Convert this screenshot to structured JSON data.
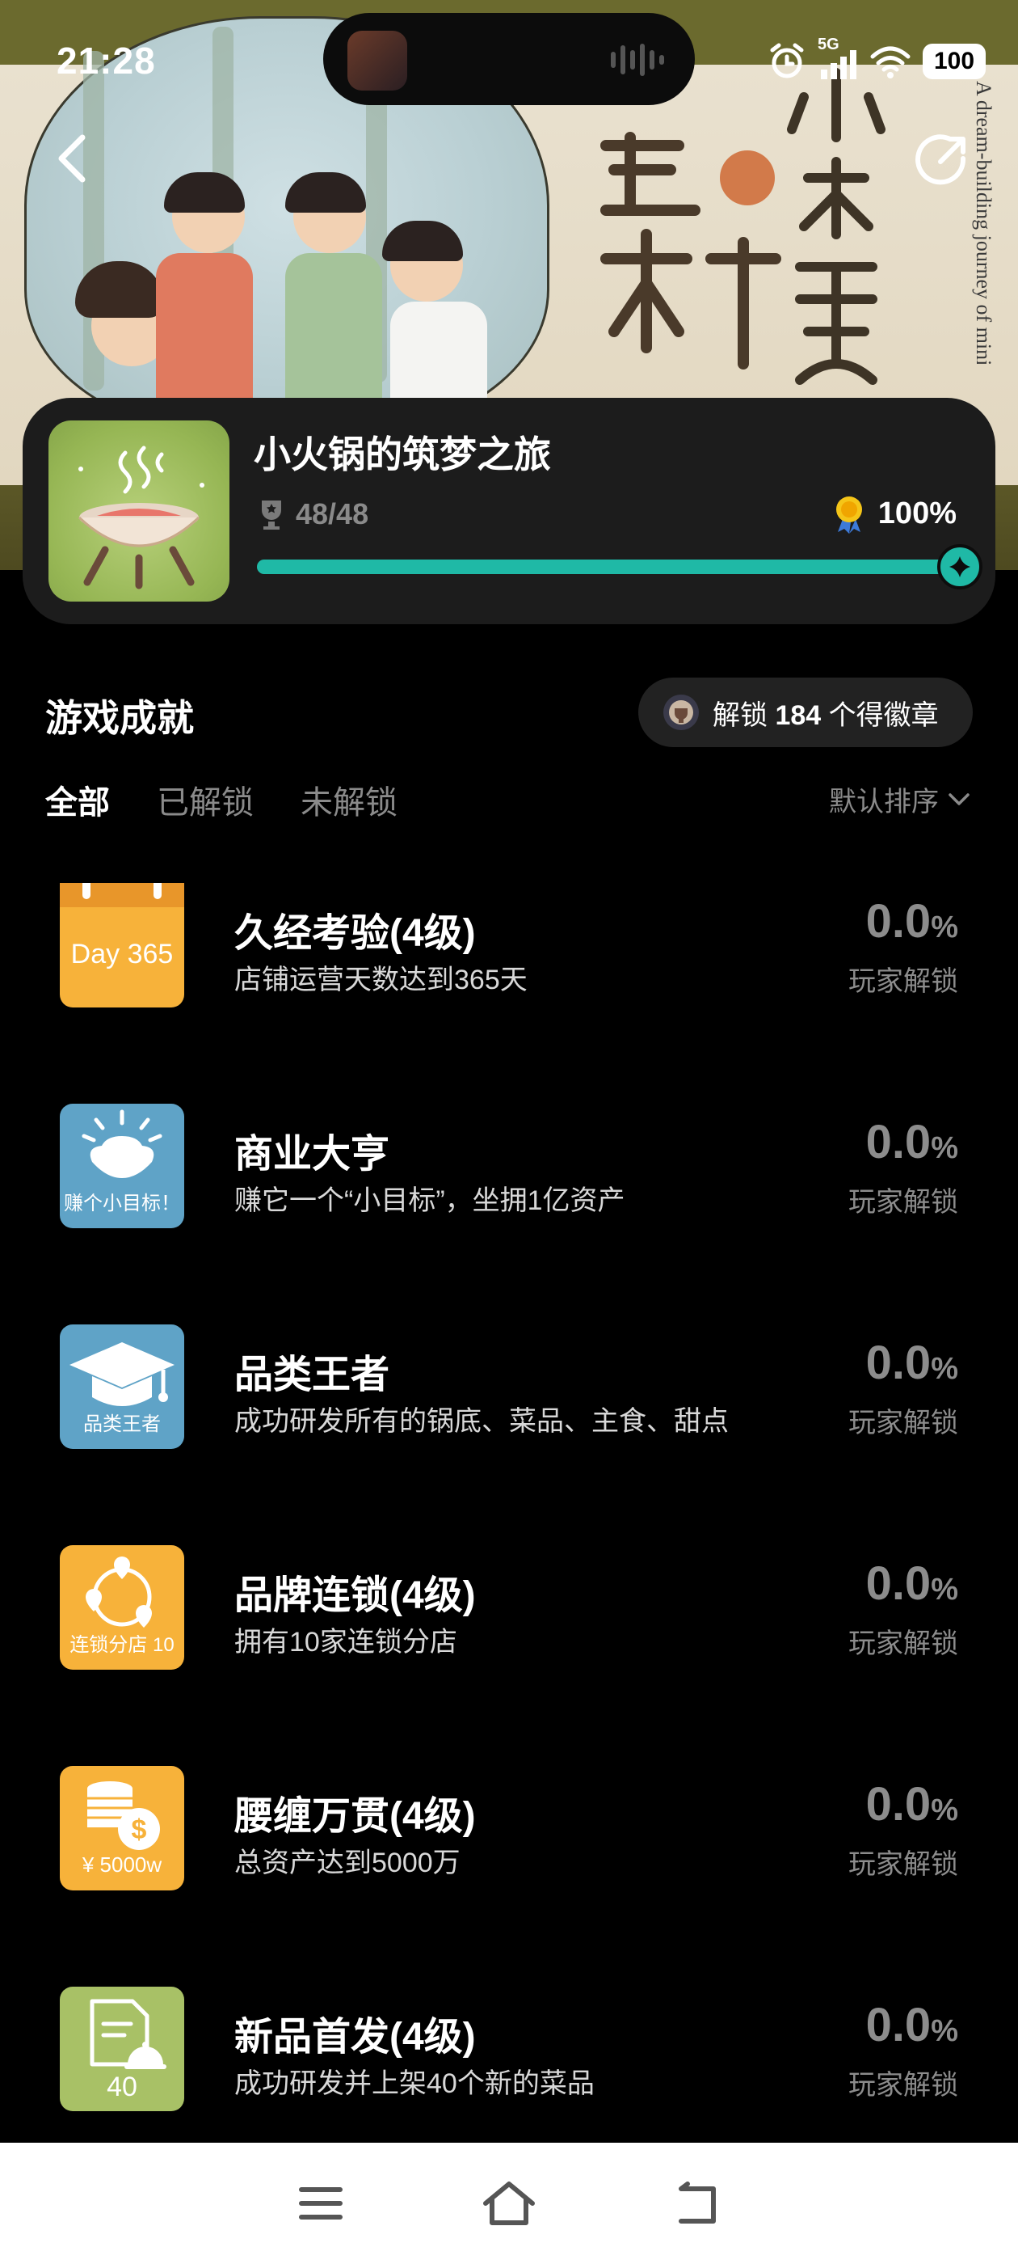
{
  "status_bar": {
    "time": "21:28",
    "network": "5G",
    "battery": "100"
  },
  "banner": {
    "vertical_english": "A dream-building journey of mini hot pot"
  },
  "game": {
    "title": "小火锅的筑梦之旅",
    "count": "48/48",
    "percent": "100%",
    "progress": 1.0,
    "accent_color": "#1fb9a6"
  },
  "achievements_header": {
    "title": "游戏成就",
    "badge_text_prefix": "解锁",
    "badge_count": "184",
    "badge_text_suffix": "个得徽章"
  },
  "tabs": [
    {
      "label": "全部",
      "active": true
    },
    {
      "label": "已解锁",
      "active": false
    },
    {
      "label": "未解锁",
      "active": false
    }
  ],
  "sort": {
    "label": "默认排序"
  },
  "achievements": [
    {
      "name": "久经考验(4级)",
      "desc": "店铺运营天数达到365天",
      "pct": "0.0",
      "pct_unit": "%",
      "unlock_label": "玩家解锁",
      "icon_text": "Day 365",
      "icon": "calendar-icon",
      "color": "#f7b23a"
    },
    {
      "name": "商业大亨",
      "desc": "赚它一个“小目标”，坐拥1亿资产",
      "pct": "0.0",
      "pct_unit": "%",
      "unlock_label": "玩家解锁",
      "icon_text": "赚个小目标！",
      "icon": "gold-ingot-icon",
      "color": "#5fa3c7"
    },
    {
      "name": "品类王者",
      "desc": "成功研发所有的锅底、菜品、主食、甜点",
      "pct": "0.0",
      "pct_unit": "%",
      "unlock_label": "玩家解锁",
      "icon_text": "品类王者",
      "icon": "graduation-cap-icon",
      "color": "#5fa3c7"
    },
    {
      "name": "品牌连锁(4级)",
      "desc": "拥有10家连锁分店",
      "pct": "0.0",
      "pct_unit": "%",
      "unlock_label": "玩家解锁",
      "icon_text": "连锁分店 10",
      "icon": "location-network-icon",
      "color": "#f7b23a"
    },
    {
      "name": "腰缠万贯(4级)",
      "desc": "总资产达到5000万",
      "pct": "0.0",
      "pct_unit": "%",
      "unlock_label": "玩家解锁",
      "icon_text": "¥ 5000w",
      "icon": "coins-icon",
      "color": "#f7b23a"
    },
    {
      "name": "新品首发(4级)",
      "desc": "成功研发并上架40个新的菜品",
      "pct": "0.0",
      "pct_unit": "%",
      "unlock_label": "玩家解锁",
      "icon_text": "40",
      "icon": "recipe-dish-icon",
      "color": "#a8c166"
    }
  ]
}
